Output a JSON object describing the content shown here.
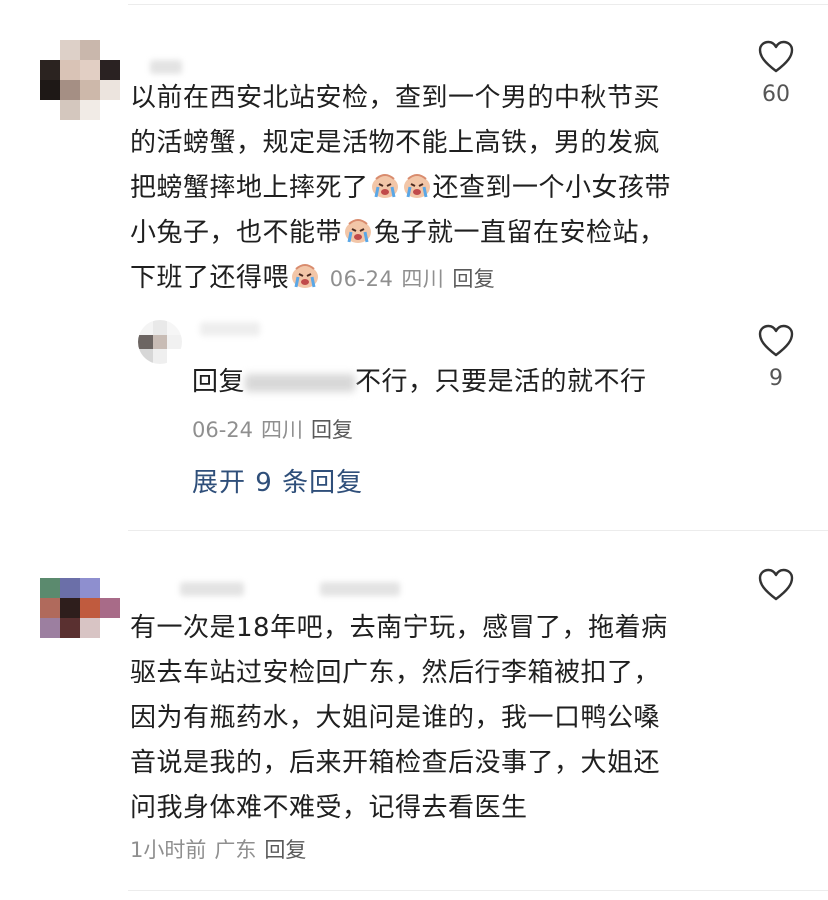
{
  "comments": [
    {
      "lines": [
        "以前在西安北站安检，查到一个男的中秋节买",
        "的活螃蟹，规定是活物不能上高铁，男的发疯",
        "把螃蟹摔地上摔死了",
        "还查到一个小女孩带",
        "小兔子，也不能带",
        "兔子就一直留在安检站，",
        "下班了还得喂"
      ],
      "time": "06-24",
      "location": "四川",
      "reply_label": "回复",
      "likes": "60",
      "emoji": "crying-emoji"
    },
    {
      "reply_prefix": "回复",
      "text": "不行，只要是活的就不行",
      "time": "06-24",
      "location": "四川",
      "reply_label": "回复",
      "likes": "9"
    },
    {
      "lines": [
        "有一次是18年吧，去南宁玩，感冒了，拖着病",
        "驱去车站过安检回广东，然后行李箱被扣了，",
        "因为有瓶药水，大姐问是谁的，我一口鸭公嗓",
        "音说是我的，后来开箱检查后没事了，大姐还",
        "问我身体难不难受，记得去看医生"
      ],
      "time": "1小时前",
      "location": "广东",
      "reply_label": "回复",
      "likes": ""
    }
  ],
  "expand_replies": "展开 9 条回复",
  "colors": {
    "text": "#1f1f1f",
    "meta": "#8f8f8f",
    "link": "#2f4f7a",
    "divider": "#ececec"
  }
}
